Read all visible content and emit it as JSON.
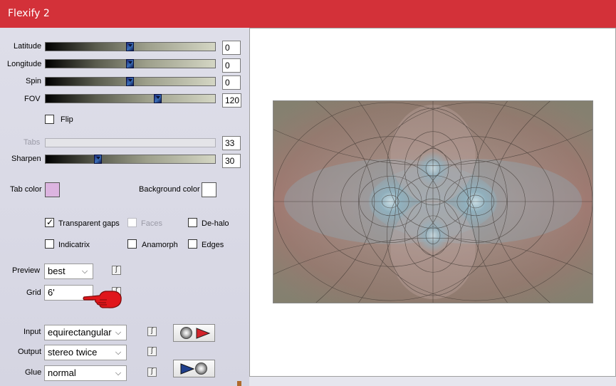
{
  "window": {
    "title": "Flexify 2"
  },
  "colors": {
    "titlebar": "#d33139",
    "tab_color": "#dcb4e0",
    "background_color": "#ffffff"
  },
  "sliders": [
    {
      "key": "latitude",
      "label": "Latitude",
      "value": "0",
      "level": 0.5
    },
    {
      "key": "longitude",
      "label": "Longitude",
      "value": "0",
      "level": 0.5
    },
    {
      "key": "spin",
      "label": "Spin",
      "value": "0",
      "level": 0.5
    },
    {
      "key": "fov",
      "label": "FOV",
      "value": "120",
      "level": 0.667
    },
    {
      "key": "tabs",
      "label": "Tabs",
      "value": "33",
      "level": 0.0,
      "disabled": true
    },
    {
      "key": "sharpen",
      "label": "Sharpen",
      "value": "30",
      "level": 0.3
    }
  ],
  "flip": {
    "label": "Flip",
    "checked": false
  },
  "tab_color": {
    "label": "Tab color"
  },
  "background_color": {
    "label": "Background color"
  },
  "checks": {
    "transparent_gaps": {
      "label": "Transparent gaps",
      "checked": true
    },
    "faces": {
      "label": "Faces",
      "checked": false,
      "disabled": true
    },
    "dehalo": {
      "label": "De-halo",
      "checked": false
    },
    "indicatrix": {
      "label": "Indicatrix",
      "checked": false
    },
    "anamorph": {
      "label": "Anamorph",
      "checked": false
    },
    "edges": {
      "label": "Edges",
      "checked": false
    }
  },
  "dropdowns": {
    "preview": {
      "label": "Preview",
      "value": "best"
    },
    "grid": {
      "label": "Grid",
      "value": "6'"
    },
    "input": {
      "label": "Input",
      "value": "equirectangular"
    },
    "output": {
      "label": "Output",
      "value": "stereo twice"
    },
    "glue": {
      "label": "Glue",
      "value": "normal"
    }
  },
  "icons": {
    "link": "link-icon",
    "chevron": "chevron-down-icon",
    "hand": "pointing-hand-icon",
    "disc": "disc-icon",
    "arrow": "arrow-right-icon"
  },
  "glyphs": {
    "chevron": "⌵",
    "check": "✓",
    "link": "ʃ"
  }
}
